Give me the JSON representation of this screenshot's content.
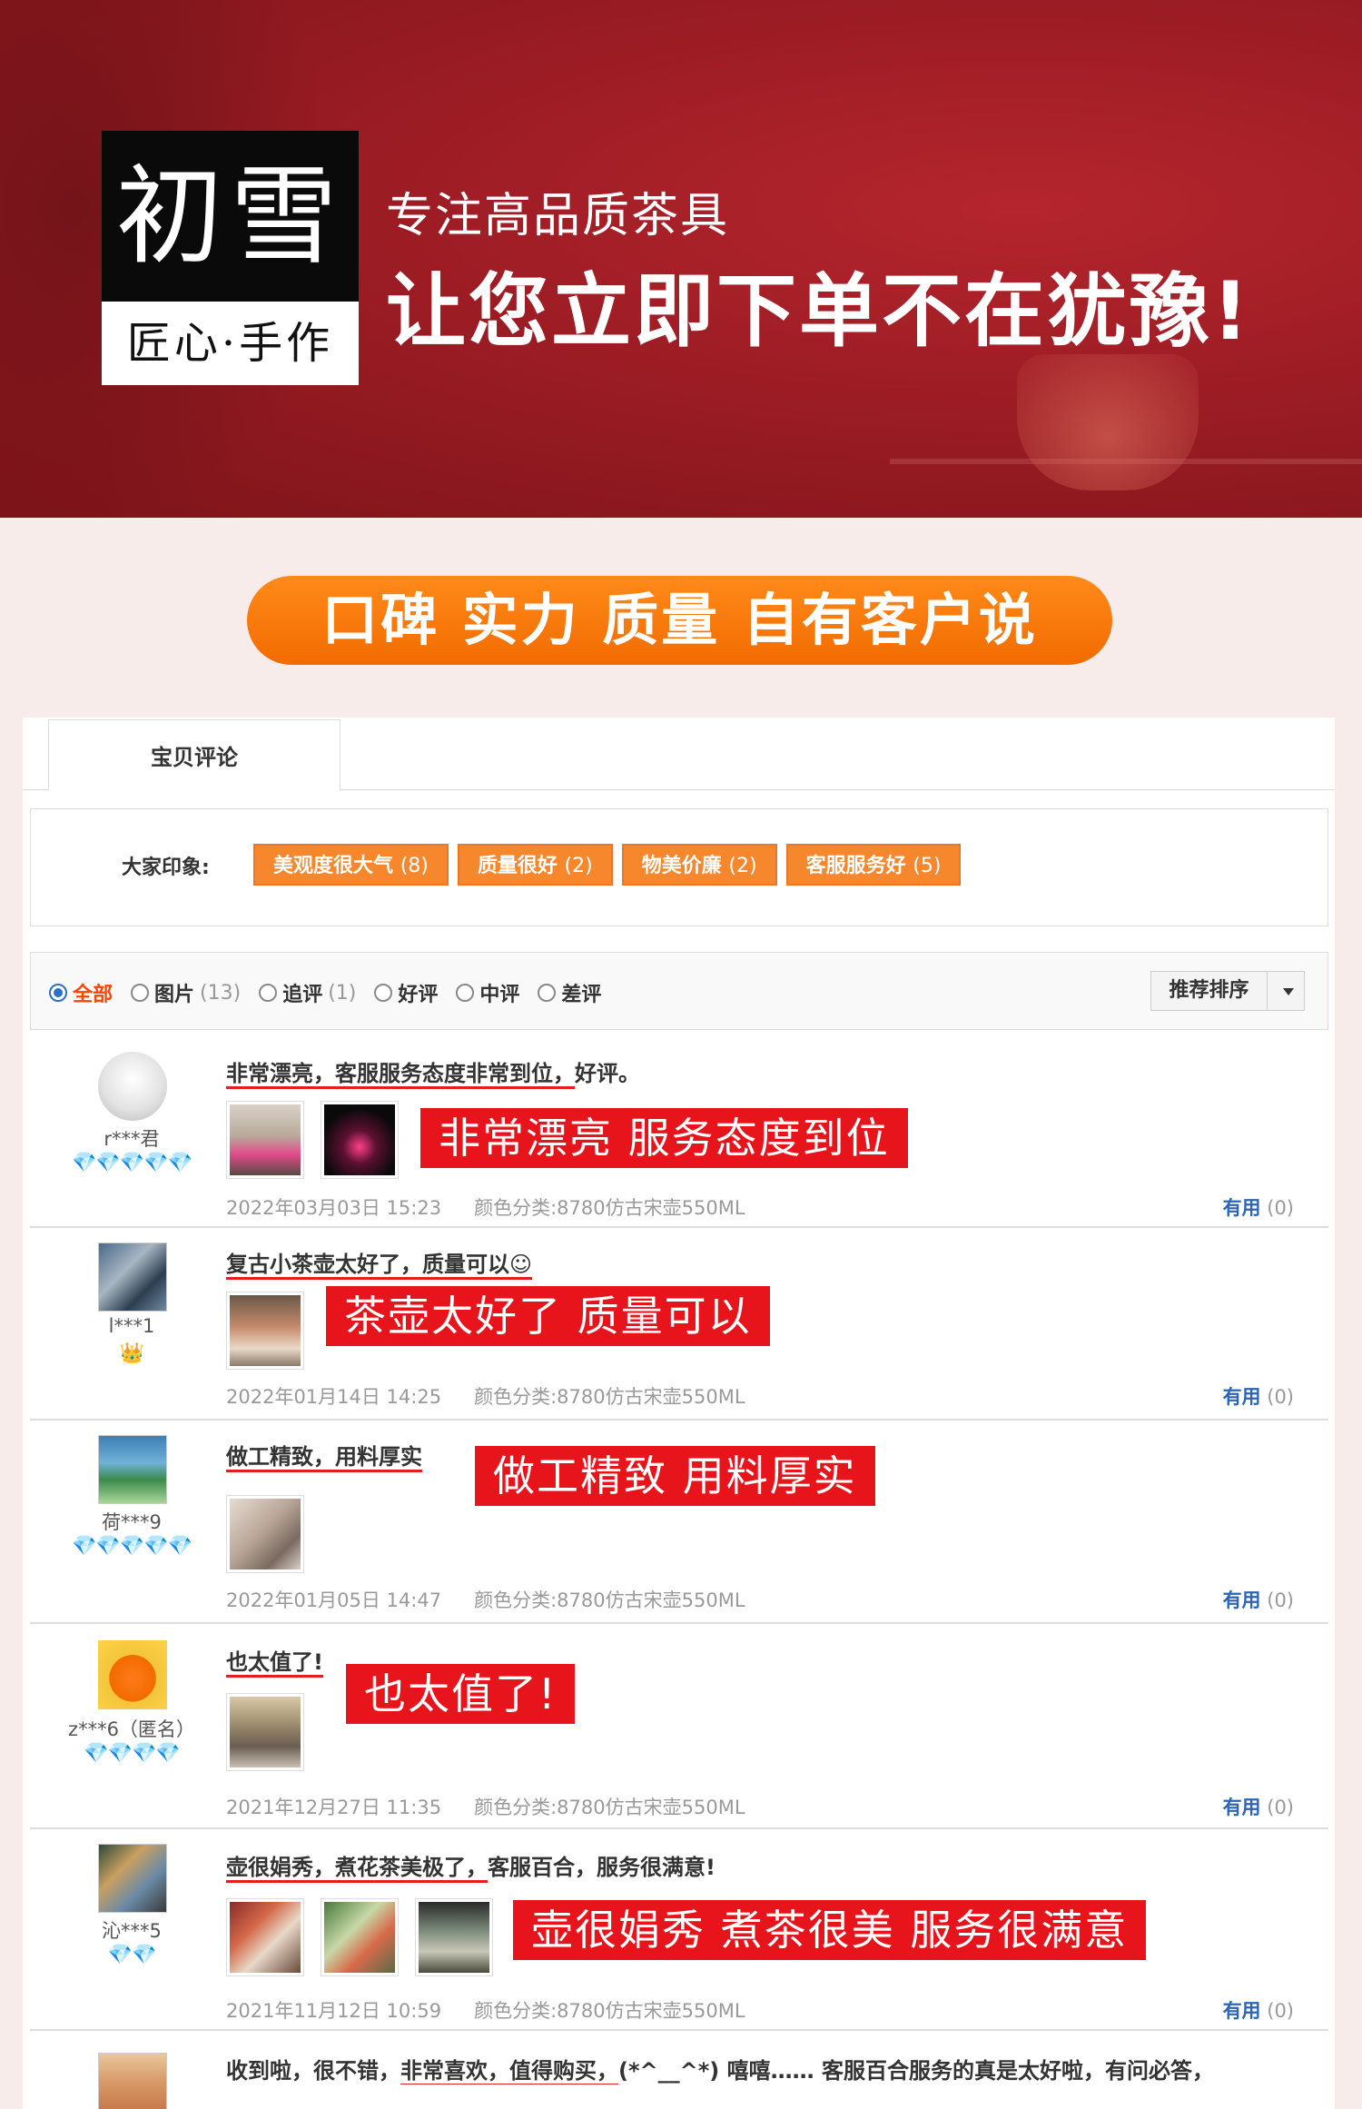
{
  "banner": {
    "logo_top": "初雪",
    "logo_bottom": "匠心·手作",
    "slogan_small": "专注高品质茶具",
    "slogan_big": "让您立即下单不在犹豫!"
  },
  "pill": {
    "text": "口碑 实力 质量 自有客户说"
  },
  "widget": {
    "tab": "宝贝评论",
    "impress_label": "大家印象:",
    "tags": [
      {
        "label": "美观度很大气",
        "count": "(8)"
      },
      {
        "label": "质量很好",
        "count": "(2)"
      },
      {
        "label": "物美价廉",
        "count": "(2)"
      },
      {
        "label": "客服服务好",
        "count": "(5)"
      }
    ],
    "filters": [
      {
        "label": "全部",
        "count": ""
      },
      {
        "label": "图片",
        "count": "(13)"
      },
      {
        "label": "追评",
        "count": "(1)"
      },
      {
        "label": "好评",
        "count": ""
      },
      {
        "label": "中评",
        "count": ""
      },
      {
        "label": "差评",
        "count": ""
      }
    ],
    "sort_label": "推荐排序",
    "color_label": "颜色分类:",
    "useful_label": "有用",
    "useful_count": "(0)"
  },
  "reviews": [
    {
      "user": "r***君",
      "rank": "💎💎💎💎💎",
      "text1": "非常漂亮，",
      "text2": "客服服务态度非常到位，",
      "text3": "好评。",
      "highlight": "非常漂亮 服务态度到位",
      "date": "2022年03月03日 15:23",
      "color": "8780仿古宋壶550ML"
    },
    {
      "user": "l***1",
      "rank": "👑",
      "text1": "复古小茶壶太好了，",
      "text2": "质量可以☺",
      "text3": "",
      "highlight": "茶壶太好了 质量可以",
      "date": "2022年01月14日 14:25",
      "color": "8780仿古宋壶550ML"
    },
    {
      "user": "荷***9",
      "rank": "💎💎💎💎💎",
      "text1": "做工精致，",
      "text2": "用料厚实",
      "text3": "",
      "highlight": "做工精致 用料厚实",
      "date": "2022年01月05日 14:47",
      "color": "8780仿古宋壶550ML"
    },
    {
      "user": "z***6（匿名）",
      "rank": "💎💎💎💎",
      "text1": "也太值了!",
      "text2": "",
      "text3": "",
      "highlight": "也太值了!",
      "date": "2021年12月27日 11:35",
      "color": "8780仿古宋壶550ML"
    },
    {
      "user": "沁***5",
      "rank": "💎💎",
      "text1": "壶很娟秀，",
      "text2": "煮花茶美极了，",
      "text3": "客服百合，服务很满意!",
      "highlight": "壶很娟秀 煮茶很美 服务很满意",
      "date": "2021年11月12日 10:59",
      "color": "8780仿古宋壶550ML"
    },
    {
      "user": "",
      "rank": "",
      "text1": "收到啦，很不错，",
      "text2": "非常喜欢，值得购买，",
      "text3": "(*^__^*) 嘻嘻…… 客服百合服务的真是太好啦，有问必答，",
      "highlight": "",
      "date": "",
      "color": ""
    }
  ],
  "colors": {
    "banner_red": "#9c1c24",
    "pill_orange": "#f26b00",
    "tag_orange": "#f6872c",
    "highlight_red": "#e8141b",
    "useful_blue": "#2d64b3"
  }
}
